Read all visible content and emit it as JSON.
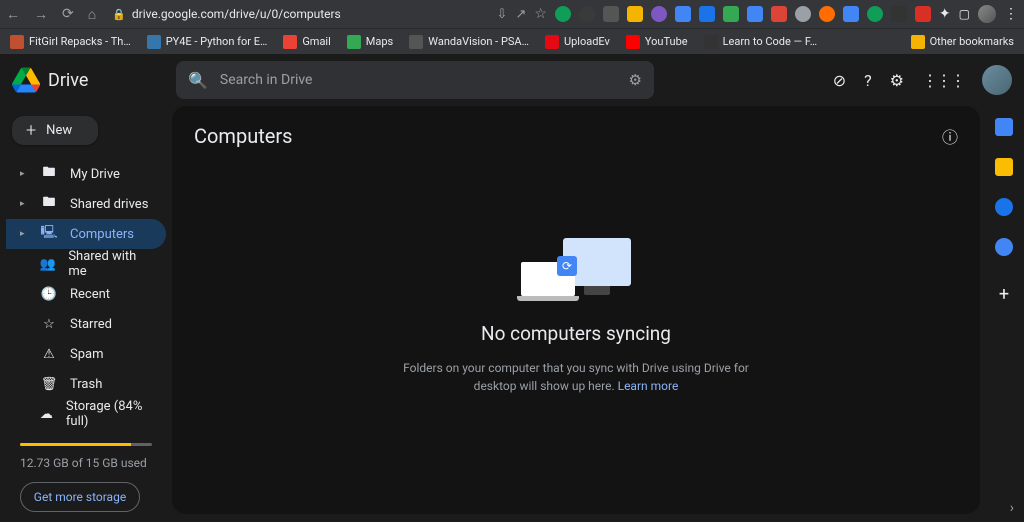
{
  "browser": {
    "url": "drive.google.com/drive/u/0/computers",
    "bookmarks": [
      {
        "label": "FitGirl Repacks - Th…",
        "color": "#c05030"
      },
      {
        "label": "PY4E - Python for E…",
        "color": "#3776ab"
      },
      {
        "label": "Gmail",
        "color": "#ea4335"
      },
      {
        "label": "Maps",
        "color": "#34a853"
      },
      {
        "label": "WandaVision - PSA…",
        "color": "#555"
      },
      {
        "label": "UploadEv",
        "color": "#e50914"
      },
      {
        "label": "YouTube",
        "color": "#ff0000"
      },
      {
        "label": "Learn to Code — F…",
        "color": "#333"
      }
    ],
    "other_bookmarks_label": "Other bookmarks"
  },
  "header": {
    "app_name": "Drive",
    "search_placeholder": "Search in Drive"
  },
  "sidebar": {
    "new_label": "New",
    "items": [
      {
        "label": "My Drive",
        "icon": "folder",
        "caret": true
      },
      {
        "label": "Shared drives",
        "icon": "shared",
        "caret": true
      },
      {
        "label": "Computers",
        "icon": "computer",
        "caret": true,
        "active": true
      },
      {
        "label": "Shared with me",
        "icon": "people",
        "caret": false
      },
      {
        "label": "Recent",
        "icon": "clock",
        "caret": false
      },
      {
        "label": "Starred",
        "icon": "star",
        "caret": false
      },
      {
        "label": "Spam",
        "icon": "spam",
        "caret": false
      },
      {
        "label": "Trash",
        "icon": "trash",
        "caret": false
      },
      {
        "label": "Storage (84% full)",
        "icon": "cloud",
        "caret": false
      }
    ],
    "storage_percent": 84,
    "storage_used_text": "12.73 GB of 15 GB used",
    "get_storage_label": "Get more storage"
  },
  "content": {
    "title": "Computers",
    "empty_title": "No computers syncing",
    "empty_sub_prefix": "Folders on your computer that you sync with Drive using Drive for desktop will show up here. ",
    "empty_learn_more": "Learn more"
  }
}
